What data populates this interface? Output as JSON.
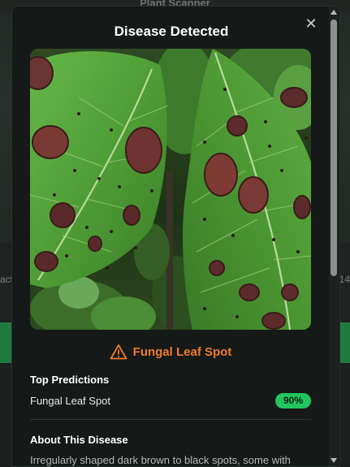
{
  "background": {
    "header_title": "Plant Scanner",
    "left_fragment": "act",
    "right_fragment": "14"
  },
  "modal": {
    "title": "Disease Detected",
    "close_icon": "close-icon",
    "photo_icon": "leaf-photo",
    "result": {
      "icon": "warning-triangle-icon",
      "label": "Fungal Leaf Spot",
      "color": "#f07a2b"
    },
    "top_predictions": {
      "heading": "Top Predictions",
      "items": [
        {
          "name": "Fungal Leaf Spot",
          "confidence": "90%"
        }
      ]
    },
    "about": {
      "heading": "About This Disease",
      "text": "Irregularly shaped dark brown to black spots, some with"
    }
  },
  "colors": {
    "accent_orange": "#f07a2b",
    "badge_green": "#22c55e",
    "action_green": "#1f7a3e"
  }
}
